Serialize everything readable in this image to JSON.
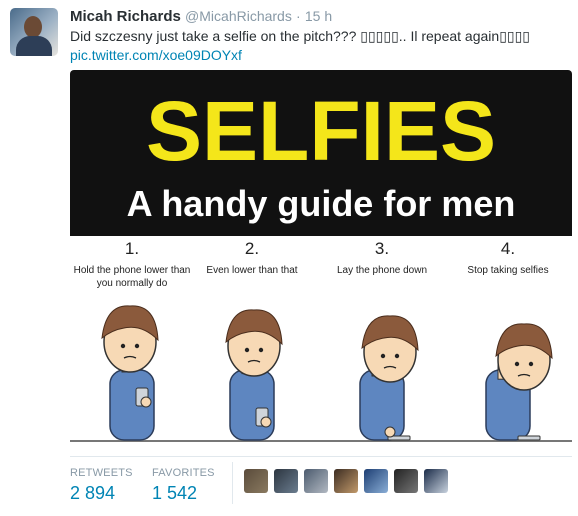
{
  "tweet": {
    "name": "Micah Richards",
    "handle": "@MicahRichards",
    "separator": "·",
    "time": "15 h",
    "text": "Did szczesny just take a selfie on the pitch??? ▯▯▯▯▯.. Il repeat again▯▯▯▯",
    "link": "pic.twitter.com/xoe09DOYxf"
  },
  "media": {
    "title": "SELFIES",
    "subtitle": "A handy guide for men",
    "steps": [
      {
        "number": "1.",
        "line1": "Hold the phone lower than",
        "line2": "you normally do"
      },
      {
        "number": "2.",
        "line1": "Even lower than that",
        "line2": ""
      },
      {
        "number": "3.",
        "line1": "Lay the phone down",
        "line2": ""
      },
      {
        "number": "4.",
        "line1": "Stop taking selfies",
        "line2": ""
      }
    ],
    "colors": {
      "banner": "#111111",
      "title": "#f4e61a",
      "subtitle": "#ffffff",
      "shirt": "#5e86c0",
      "hair": "#8b5a3c",
      "skin": "#f7d9b5"
    }
  },
  "stats": {
    "retweets_label": "RETWEETS",
    "retweets_value": "2 894",
    "favorites_label": "FAVORITES",
    "favorites_value": "1 542"
  },
  "favoriters": [
    "avatar-1",
    "avatar-2",
    "avatar-3",
    "avatar-4",
    "avatar-5",
    "avatar-6",
    "avatar-7"
  ]
}
